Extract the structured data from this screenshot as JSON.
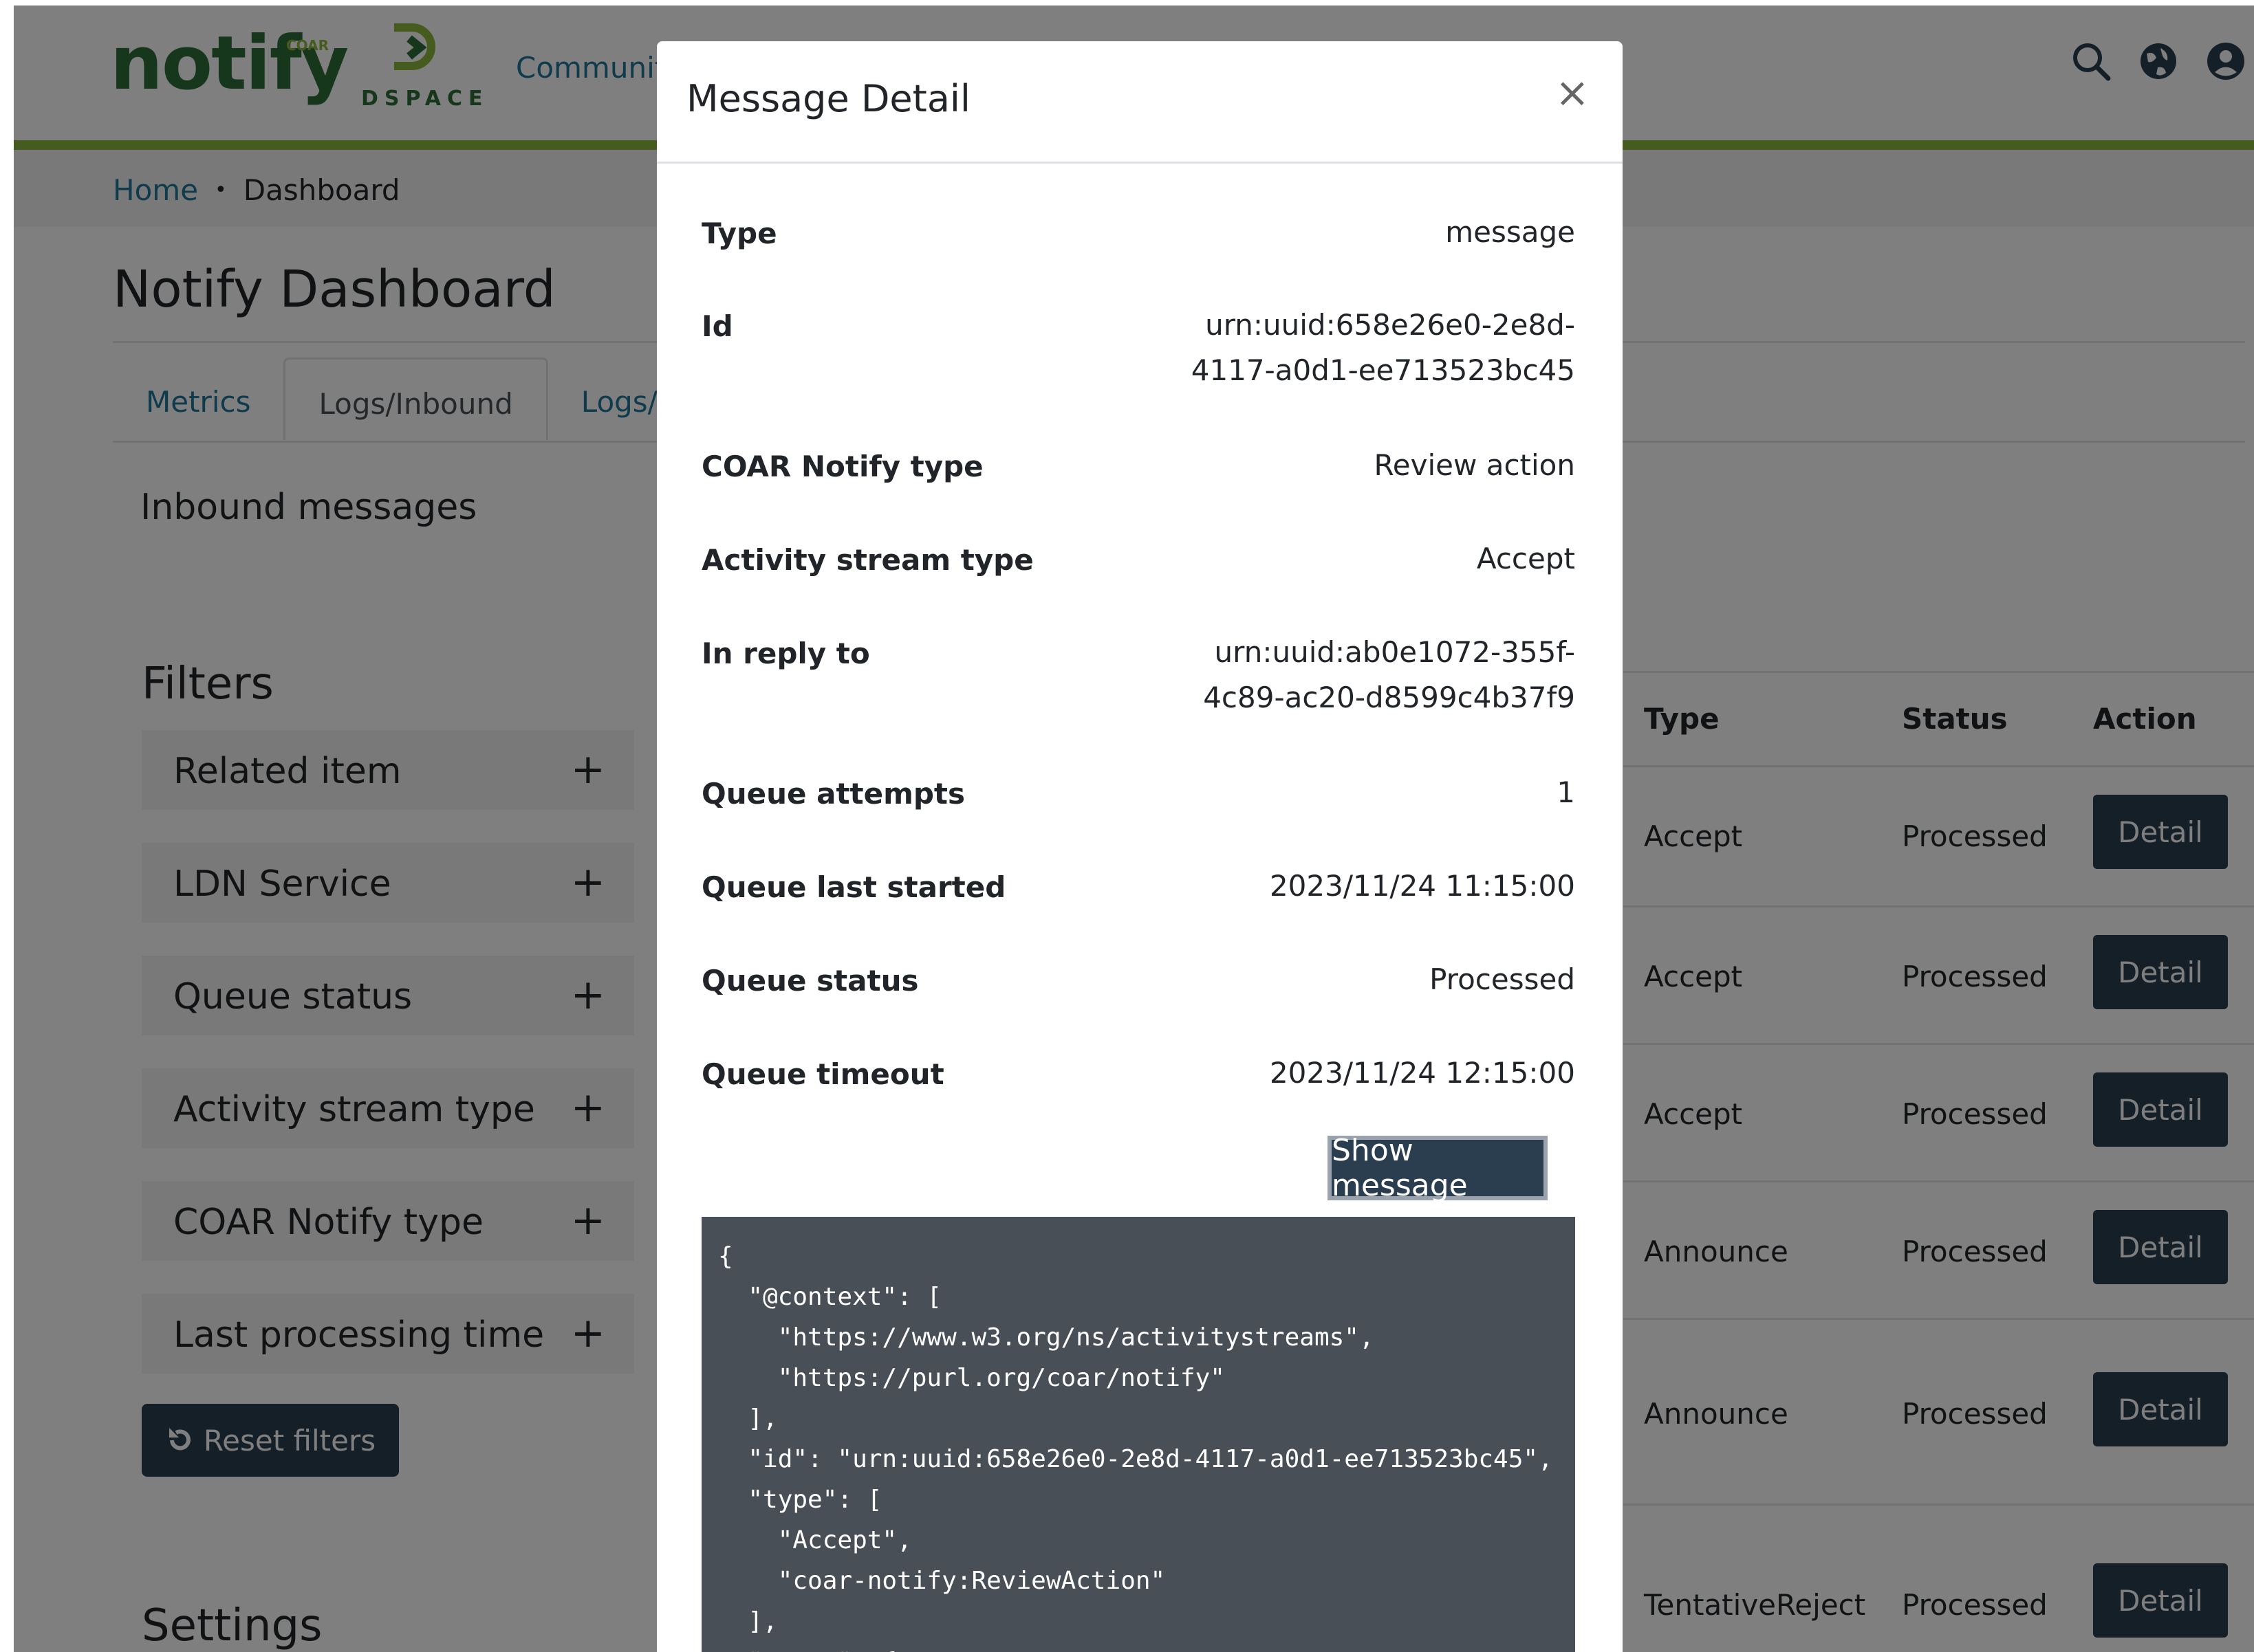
{
  "header": {
    "logo_text": "notify",
    "logo_sup": "COAR",
    "dspace_text": "DSPACE",
    "nav_community": "Communit",
    "icons": [
      "search-icon",
      "globe-icon",
      "user-icon"
    ]
  },
  "breadcrumb": {
    "home": "Home",
    "separator": "•",
    "current": "Dashboard"
  },
  "page_title": "Notify Dashboard",
  "tabs": [
    {
      "label": "Metrics"
    },
    {
      "label": "Logs/Inbound"
    },
    {
      "label": "Logs/O"
    }
  ],
  "inbound_title": "Inbound messages",
  "filters": {
    "title": "Filters",
    "items": [
      {
        "label": "Related item",
        "icon": "+"
      },
      {
        "label": "LDN Service",
        "icon": "+"
      },
      {
        "label": "Queue status",
        "icon": "+"
      },
      {
        "label": "Activity stream type",
        "icon": "+"
      },
      {
        "label": "COAR Notify type",
        "icon": "+"
      },
      {
        "label": "Last processing time",
        "icon": "+"
      }
    ],
    "reset_label": "Reset filters"
  },
  "settings_title": "Settings",
  "table": {
    "headers": {
      "type": "Type",
      "status": "Status",
      "action": "Action"
    },
    "rows": [
      {
        "type": "Accept",
        "status": "Processed",
        "action": "Detail"
      },
      {
        "type": "Accept",
        "status": "Processed",
        "action": "Detail"
      },
      {
        "type": "Accept",
        "status": "Processed",
        "action": "Detail"
      },
      {
        "type": "Announce",
        "status": "Processed",
        "action": "Detail"
      },
      {
        "type": "Announce",
        "status": "Processed",
        "action": "Detail"
      },
      {
        "type": "TentativeReject",
        "status": "Processed",
        "action": "Detail"
      }
    ]
  },
  "modal": {
    "title": "Message Detail",
    "close": "×",
    "fields": [
      {
        "label": "Type",
        "value": "message"
      },
      {
        "label": "Id",
        "value_line1": "urn:uuid:658e26e0-2e8d-",
        "value_line2": "4117-a0d1-ee713523bc45"
      },
      {
        "label": "COAR Notify type",
        "value": "Review action"
      },
      {
        "label": "Activity stream type",
        "value": "Accept"
      },
      {
        "label": "In reply to",
        "value_line1": "urn:uuid:ab0e1072-355f-",
        "value_line2": "4c89-ac20-d8599c4b37f9"
      },
      {
        "label": "Queue attempts",
        "value": "1"
      },
      {
        "label": "Queue last started",
        "value": "2023/11/24 11:15:00"
      },
      {
        "label": "Queue status",
        "value": "Processed"
      },
      {
        "label": "Queue timeout",
        "value": "2023/11/24 12:15:00"
      }
    ],
    "show_message_label": "Show message",
    "json_message": "{\n  \"@context\": [\n    \"https://www.w3.org/ns/activitystreams\",\n    \"https://purl.org/coar/notify\"\n  ],\n  \"id\": \"urn:uuid:658e26e0-2e8d-4117-a0d1-ee713523bc45\",\n  \"type\": [\n    \"Accept\",\n    \"coar-notify:ReviewAction\"\n  ],\n  \"actor\": {"
  },
  "colors": {
    "brand_green": "#2e6e3a",
    "accent_green": "#8cb63c",
    "link_blue": "#207698",
    "button_dark": "#2b3e50",
    "code_bg": "#494f57"
  }
}
